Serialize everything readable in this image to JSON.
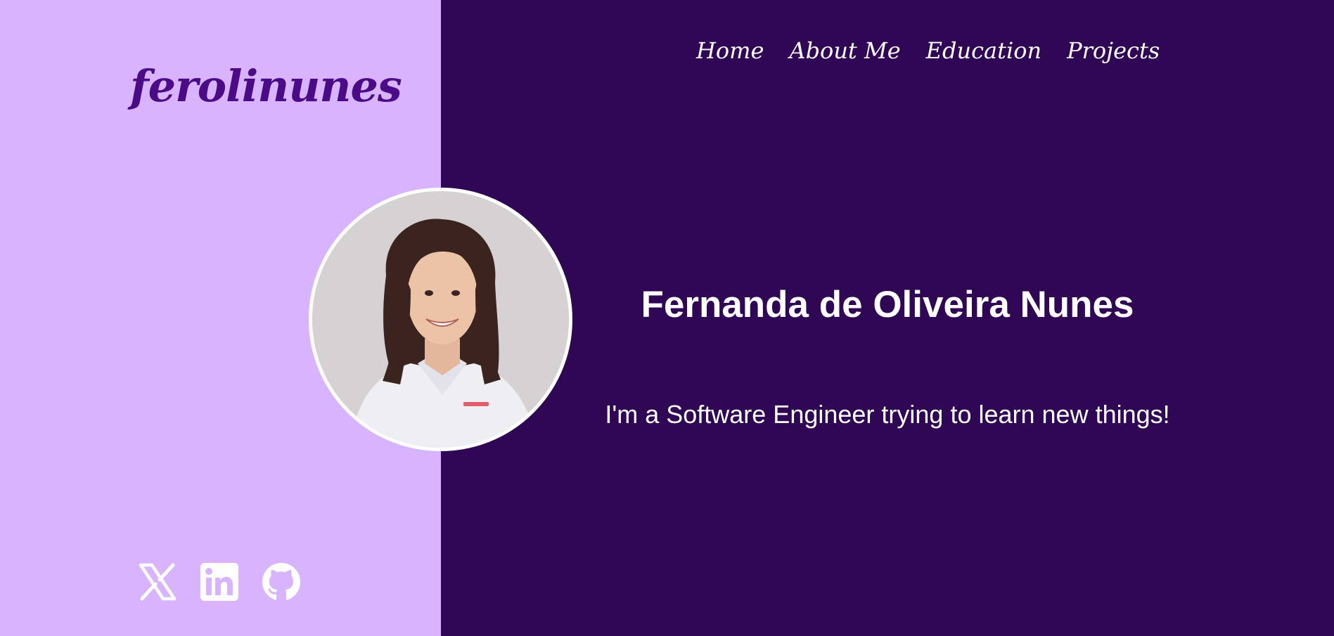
{
  "colors": {
    "left_background": "#d7b4fd",
    "right_background": "#300754",
    "logo_color": "#4b0a86",
    "text_color": "#ffffff"
  },
  "logo": {
    "text": "ferolinunes"
  },
  "nav": {
    "items": [
      {
        "label": "Home"
      },
      {
        "label": "About Me"
      },
      {
        "label": "Education"
      },
      {
        "label": "Projects"
      }
    ]
  },
  "hero": {
    "name": "Fernanda de Oliveira Nunes",
    "tagline": "I'm a Software Engineer trying to learn new things!",
    "avatar": "profile-photo"
  },
  "social": {
    "icons": [
      "x-twitter-icon",
      "linkedin-icon",
      "github-icon"
    ]
  }
}
